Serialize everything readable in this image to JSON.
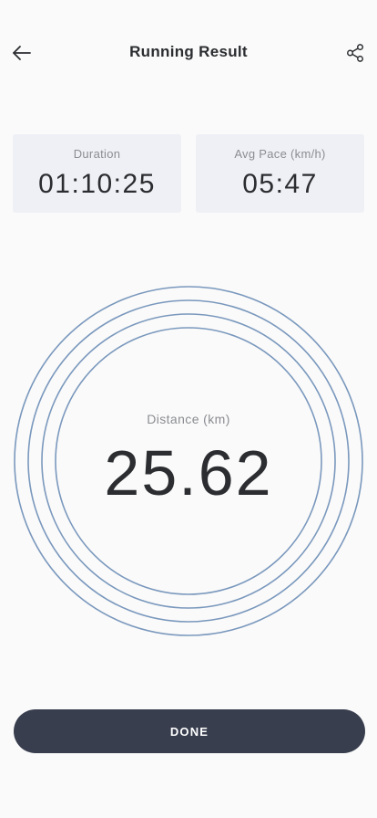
{
  "header": {
    "title": "Running Result",
    "back_icon": "arrow-left-icon",
    "share_icon": "share-icon"
  },
  "stats": {
    "duration": {
      "label": "Duration",
      "value": "01:10:25"
    },
    "avg_pace": {
      "label": "Avg Pace (km/h)",
      "value": "05:47"
    }
  },
  "distance": {
    "label": "Distance (km)",
    "value": "25.62"
  },
  "actions": {
    "done_label": "DONE"
  },
  "colors": {
    "background": "#fafafa",
    "card": "#eff0f5",
    "ring": "#7a98bd",
    "button": "#383e4e",
    "text": "#2b2d30",
    "muted": "#8b8d92"
  }
}
